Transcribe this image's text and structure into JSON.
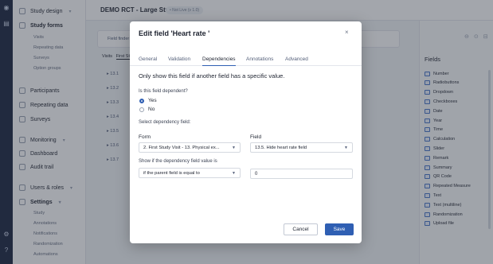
{
  "app": {
    "study_title": "DEMO RCT - Large Study",
    "study_badge": "• Not Live (v 1.0)"
  },
  "sidebar": {
    "study_design": "Study design",
    "study_forms": "Study forms",
    "study_forms_subs": [
      "Visits",
      "Repeating data",
      "Surveys",
      "Option groups"
    ],
    "participants": "Participants",
    "repeating_data": "Repeating data",
    "surveys": "Surveys",
    "monitoring": "Monitoring",
    "dashboard": "Dashboard",
    "audit_trail": "Audit trail",
    "users_roles": "Users & roles",
    "settings": "Settings",
    "settings_subs": [
      "Study",
      "Annotations",
      "Notifications",
      "Randomization",
      "Automations"
    ]
  },
  "main": {
    "field_finder": "Field finder",
    "visits_label": "Visits",
    "visits_tab": "First St",
    "tree_rows": [
      "13.1",
      "13.2",
      "13.3",
      "13.4",
      "13.5",
      "13.6",
      "13.7"
    ]
  },
  "fields_panel": {
    "title": "Fields",
    "items": [
      "Number",
      "Radiobuttons",
      "Dropdown",
      "Checkboxes",
      "Date",
      "Year",
      "Time",
      "Calculation",
      "Slider",
      "Remark",
      "Summary",
      "QR Code",
      "Repeated Measure",
      "Text",
      "Text (multiline)",
      "Randomization",
      "Upload file"
    ]
  },
  "modal": {
    "title": "Edit field 'Heart rate '",
    "close": "×",
    "tabs": [
      "General",
      "Validation",
      "Dependencies",
      "Annotations",
      "Advanced"
    ],
    "active_tab": "Dependencies",
    "lead": "Only show this field if another field has a specific value.",
    "q_dependent": "Is this field dependent?",
    "opt_yes": "Yes",
    "opt_no": "No",
    "q_select_field": "Select dependency field:",
    "form_label": "Form",
    "form_value": "2. First Study Visit - 13. Physical ex...",
    "field_label": "Field",
    "field_value": "13.5. Hide heart rate field",
    "condition_label": "Show if the dependency field value is",
    "condition_value": "if the parent field is equal to",
    "condition_input": "0",
    "cancel": "Cancel",
    "save": "Save"
  },
  "colors": {
    "accent": "#2f5fb3",
    "rail": "#1f2a44"
  }
}
